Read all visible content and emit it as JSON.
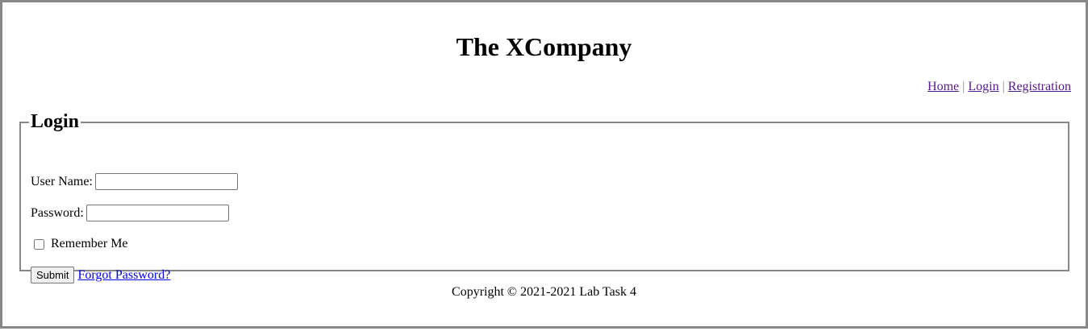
{
  "header": {
    "title": "The XCompany"
  },
  "nav": {
    "items": [
      {
        "label": "Home"
      },
      {
        "label": "Login"
      },
      {
        "label": "Registration"
      }
    ],
    "separator": "|"
  },
  "login": {
    "legend": "Login",
    "username_label": "User Name:",
    "username_value": "",
    "password_label": "Password:",
    "password_value": "",
    "remember_label": "Remember Me",
    "remember_checked": false,
    "submit_label": "Submit",
    "forgot_label": "Forgot Password?"
  },
  "footer": {
    "copyright": "Copyright © 2021-2021 Lab Task 4"
  },
  "colors": {
    "visited_link": "#551a8b",
    "link": "#0000ee",
    "border": "#888888"
  }
}
